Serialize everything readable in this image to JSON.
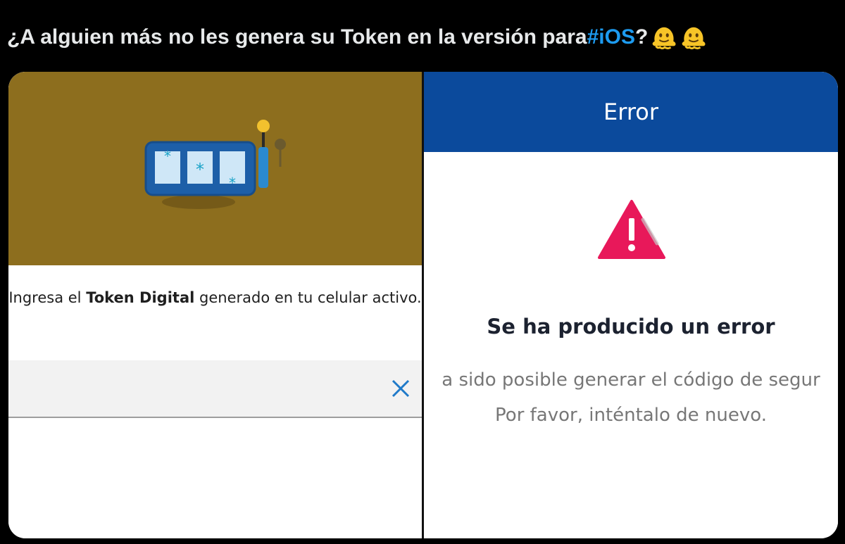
{
  "tweet": {
    "text_before": "¿A alguien más no les genera su Token en la versión para ",
    "hashtag": "#iOS",
    "text_after": "?",
    "emojis": [
      "melting-face-emoji",
      "melting-face-emoji"
    ]
  },
  "left_screen": {
    "banner_color": "#8d6e1e",
    "illustration": "token-slot-machine-illustration",
    "instruction_prefix": "Ingresa el ",
    "instruction_bold": "Token Digital",
    "instruction_suffix": " generado en tu celular activo.",
    "token_input_value": "",
    "clear_icon": "close-icon"
  },
  "right_screen": {
    "header_title": "Error",
    "header_color": "#0b4a9c",
    "warning_icon": "warning-triangle-icon",
    "warning_color": "#e8185a",
    "error_title": "Se ha producido un error",
    "error_message_line1": "a sido posible generar el código de segur",
    "error_message_line2": "Por favor, inténtalo de nuevo."
  },
  "colors": {
    "background": "#000000",
    "tweet_text": "#e7e9ea",
    "hashtag": "#1d9bf0"
  }
}
